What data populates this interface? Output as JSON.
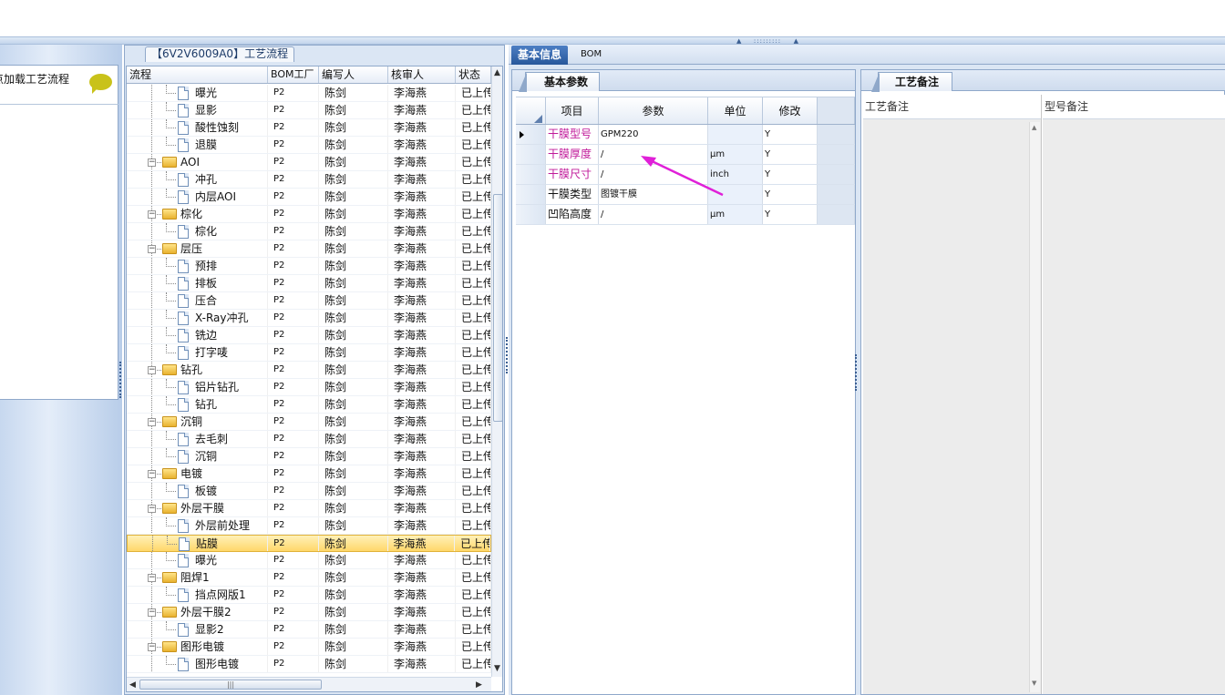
{
  "left_panel": {
    "load_label": "点加载工艺流程",
    "comment_icon": "speech-bubble-icon"
  },
  "tree_panel": {
    "tab_label": "【6V2V6009A0】工艺流程",
    "columns": [
      "流程",
      "BOM工厂",
      "编写人",
      "核审人",
      "状态"
    ],
    "rows": [
      {
        "label": "曝光",
        "type": "leaf",
        "bom": "P2",
        "writer": "陈剑",
        "reviewer": "李海燕",
        "status": "已上传"
      },
      {
        "label": "显影",
        "type": "leaf",
        "bom": "P2",
        "writer": "陈剑",
        "reviewer": "李海燕",
        "status": "已上传"
      },
      {
        "label": "酸性蚀刻",
        "type": "leaf",
        "bom": "P2",
        "writer": "陈剑",
        "reviewer": "李海燕",
        "status": "已上传"
      },
      {
        "label": "退膜",
        "type": "leaf",
        "bom": "P2",
        "writer": "陈剑",
        "reviewer": "李海燕",
        "status": "已上传"
      },
      {
        "label": "AOI",
        "type": "folder",
        "bom": "P2",
        "writer": "陈剑",
        "reviewer": "李海燕",
        "status": "已上传"
      },
      {
        "label": "冲孔",
        "type": "leaf",
        "bom": "P2",
        "writer": "陈剑",
        "reviewer": "李海燕",
        "status": "已上传"
      },
      {
        "label": "内层AOI",
        "type": "leaf",
        "bom": "P2",
        "writer": "陈剑",
        "reviewer": "李海燕",
        "status": "已上传"
      },
      {
        "label": "棕化",
        "type": "folder",
        "bom": "P2",
        "writer": "陈剑",
        "reviewer": "李海燕",
        "status": "已上传"
      },
      {
        "label": "棕化",
        "type": "leaf",
        "bom": "P2",
        "writer": "陈剑",
        "reviewer": "李海燕",
        "status": "已上传"
      },
      {
        "label": "层压",
        "type": "folder",
        "bom": "P2",
        "writer": "陈剑",
        "reviewer": "李海燕",
        "status": "已上传"
      },
      {
        "label": "预排",
        "type": "leaf",
        "bom": "P2",
        "writer": "陈剑",
        "reviewer": "李海燕",
        "status": "已上传"
      },
      {
        "label": "排板",
        "type": "leaf",
        "bom": "P2",
        "writer": "陈剑",
        "reviewer": "李海燕",
        "status": "已上传"
      },
      {
        "label": "压合",
        "type": "leaf",
        "bom": "P2",
        "writer": "陈剑",
        "reviewer": "李海燕",
        "status": "已上传"
      },
      {
        "label": "X-Ray冲孔",
        "type": "leaf",
        "bom": "P2",
        "writer": "陈剑",
        "reviewer": "李海燕",
        "status": "已上传"
      },
      {
        "label": "铣边",
        "type": "leaf",
        "bom": "P2",
        "writer": "陈剑",
        "reviewer": "李海燕",
        "status": "已上传"
      },
      {
        "label": "打字唛",
        "type": "leaf",
        "bom": "P2",
        "writer": "陈剑",
        "reviewer": "李海燕",
        "status": "已上传"
      },
      {
        "label": "钻孔",
        "type": "folder",
        "bom": "P2",
        "writer": "陈剑",
        "reviewer": "李海燕",
        "status": "已上传"
      },
      {
        "label": "铝片钻孔",
        "type": "leaf",
        "bom": "P2",
        "writer": "陈剑",
        "reviewer": "李海燕",
        "status": "已上传"
      },
      {
        "label": "钻孔",
        "type": "leaf",
        "bom": "P2",
        "writer": "陈剑",
        "reviewer": "李海燕",
        "status": "已上传"
      },
      {
        "label": "沉铜",
        "type": "folder",
        "bom": "P2",
        "writer": "陈剑",
        "reviewer": "李海燕",
        "status": "已上传"
      },
      {
        "label": "去毛刺",
        "type": "leaf",
        "bom": "P2",
        "writer": "陈剑",
        "reviewer": "李海燕",
        "status": "已上传"
      },
      {
        "label": "沉铜",
        "type": "leaf",
        "bom": "P2",
        "writer": "陈剑",
        "reviewer": "李海燕",
        "status": "已上传"
      },
      {
        "label": "电镀",
        "type": "folder",
        "bom": "P2",
        "writer": "陈剑",
        "reviewer": "李海燕",
        "status": "已上传"
      },
      {
        "label": "板镀",
        "type": "leaf",
        "bom": "P2",
        "writer": "陈剑",
        "reviewer": "李海燕",
        "status": "已上传"
      },
      {
        "label": "外层干膜",
        "type": "folder",
        "bom": "P2",
        "writer": "陈剑",
        "reviewer": "李海燕",
        "status": "已上传"
      },
      {
        "label": "外层前处理",
        "type": "leaf",
        "bom": "P2",
        "writer": "陈剑",
        "reviewer": "李海燕",
        "status": "已上传"
      },
      {
        "label": "贴膜",
        "type": "leaf",
        "bom": "P2",
        "writer": "陈剑",
        "reviewer": "李海燕",
        "status": "已上传",
        "selected": true
      },
      {
        "label": "曝光",
        "type": "leaf",
        "bom": "P2",
        "writer": "陈剑",
        "reviewer": "李海燕",
        "status": "已上传"
      },
      {
        "label": "阻焊1",
        "type": "folder",
        "bom": "P2",
        "writer": "陈剑",
        "reviewer": "李海燕",
        "status": "已上传"
      },
      {
        "label": "挡点网版1",
        "type": "leaf",
        "bom": "P2",
        "writer": "陈剑",
        "reviewer": "李海燕",
        "status": "已上传"
      },
      {
        "label": "外层干膜2",
        "type": "folder",
        "bom": "P2",
        "writer": "陈剑",
        "reviewer": "李海燕",
        "status": "已上传"
      },
      {
        "label": "显影2",
        "type": "leaf",
        "bom": "P2",
        "writer": "陈剑",
        "reviewer": "李海燕",
        "status": "已上传"
      },
      {
        "label": "图形电镀",
        "type": "folder",
        "bom": "P2",
        "writer": "陈剑",
        "reviewer": "李海燕",
        "status": "已上传"
      },
      {
        "label": "图形电镀",
        "type": "leaf",
        "bom": "P2",
        "writer": "陈剑",
        "reviewer": "李海燕",
        "status": "已上传"
      }
    ]
  },
  "main_tabs": [
    {
      "label": "基本信息",
      "active": true
    },
    {
      "label": "BOM",
      "active": false
    }
  ],
  "params_panel": {
    "tab_label": "基本参数",
    "columns": [
      "项目",
      "参数",
      "单位",
      "修改"
    ],
    "rows": [
      {
        "item": "干膜型号",
        "value": "GPM220",
        "unit": "",
        "modify": "Y",
        "pink": true,
        "current": true
      },
      {
        "item": "干膜厚度",
        "value": "/",
        "unit": "μm",
        "modify": "Y",
        "pink": true
      },
      {
        "item": "干膜尺寸",
        "value": "/",
        "unit": "inch",
        "modify": "Y",
        "pink": true
      },
      {
        "item": "干膜类型",
        "value": "图镀干膜",
        "unit": "",
        "modify": "Y",
        "pink": false
      },
      {
        "item": "凹陷高度",
        "value": "/",
        "unit": "μm",
        "modify": "Y",
        "pink": false
      }
    ]
  },
  "notes_panel": {
    "tab_label": "工艺备注",
    "col_process": "工艺备注",
    "col_model": "型号备注"
  },
  "annotation": {
    "arrow_color": "#e020d8"
  }
}
